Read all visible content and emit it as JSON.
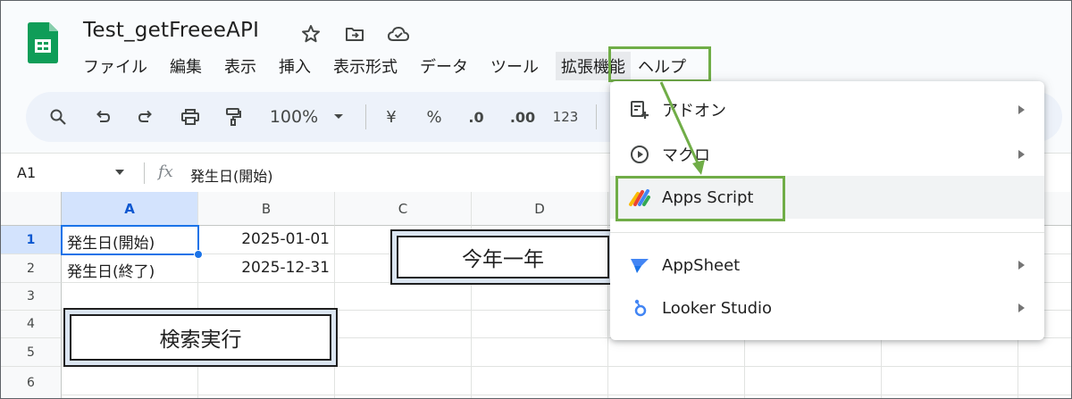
{
  "doc": {
    "title": "Test_getFreeeAPI",
    "header_icons": [
      "star-icon",
      "move-folder-icon",
      "cloud-saved-icon"
    ]
  },
  "menu": {
    "items": [
      "ファイル",
      "編集",
      "表示",
      "挿入",
      "表示形式",
      "データ",
      "ツール",
      "拡張機能",
      "ヘルプ"
    ],
    "active": "拡張機能"
  },
  "toolbar": {
    "zoom": "100%",
    "currency": "¥",
    "percent": "%",
    "dec_decrease": ".0",
    "dec_increase": ".00",
    "number_format": "123"
  },
  "formula_bar": {
    "cell_ref": "A1",
    "fx": "fx",
    "value": "発生日(開始)"
  },
  "grid": {
    "columns": [
      "A",
      "B",
      "C",
      "D"
    ],
    "rows": [
      "1",
      "2",
      "3",
      "4",
      "5",
      "6"
    ],
    "cells": {
      "A1": "発生日(開始)",
      "B1": "2025-01-01",
      "A2": "発生日(終了)",
      "B2": "2025-12-31"
    }
  },
  "buttons": {
    "search_run": "検索実行",
    "this_year": "今年一年"
  },
  "dropdown": {
    "items": [
      {
        "label": "アドオン",
        "icon": "addon-icon",
        "submenu": true
      },
      {
        "label": "マクロ",
        "icon": "macro-play-icon",
        "submenu": true
      },
      {
        "label": "Apps Script",
        "icon": "apps-script-icon",
        "submenu": false
      },
      {
        "label": "AppSheet",
        "icon": "appsheet-icon",
        "submenu": true
      },
      {
        "label": "Looker Studio",
        "icon": "looker-studio-icon",
        "submenu": true
      }
    ],
    "highlighted": "Apps Script"
  },
  "colors": {
    "highlight_green": "#70ad47",
    "selection_blue": "#1a73e8",
    "sheets_green": "#0f9d58"
  }
}
